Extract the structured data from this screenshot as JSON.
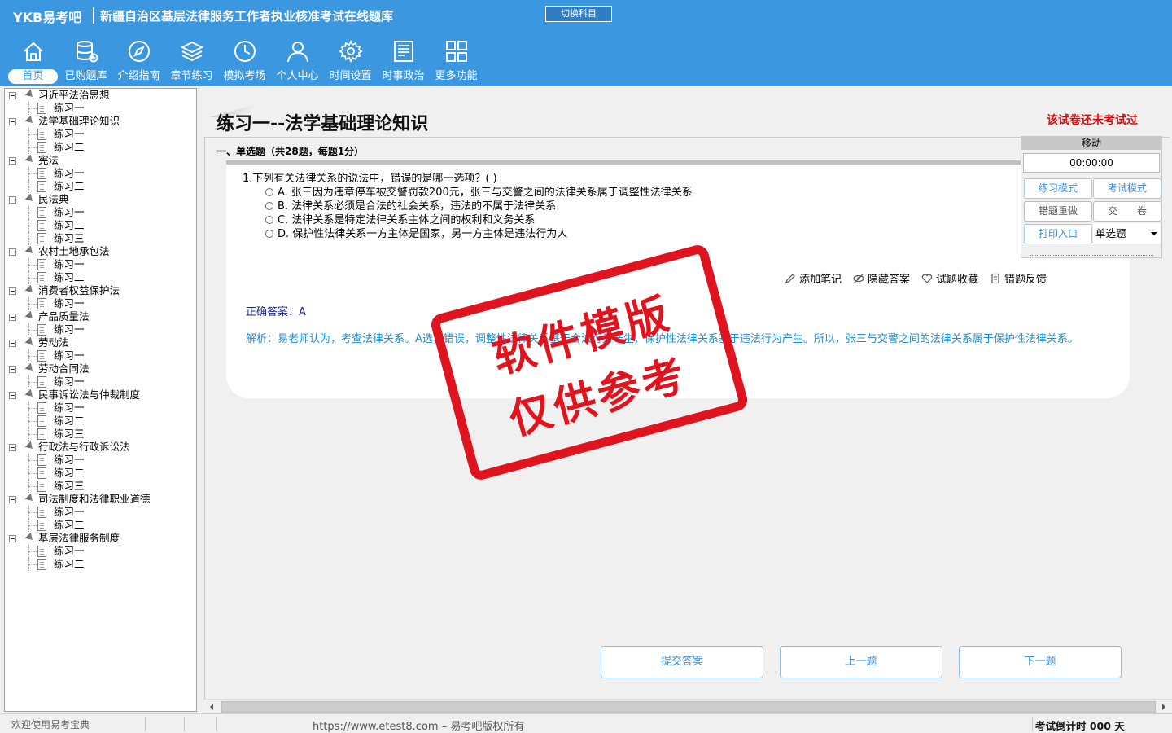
{
  "header": {
    "logo": "YKB易考吧",
    "title": "新疆自治区基层法律服务工作者执业核准考试在线题库",
    "switch_label": "切换科目"
  },
  "nav": [
    {
      "label": "首页",
      "icon": "home-icon"
    },
    {
      "label": "已购题库",
      "icon": "database-icon"
    },
    {
      "label": "介绍指南",
      "icon": "compass-icon"
    },
    {
      "label": "章节练习",
      "icon": "layers-icon"
    },
    {
      "label": "模拟考场",
      "icon": "clock-icon"
    },
    {
      "label": "个人中心",
      "icon": "user-icon"
    },
    {
      "label": "时间设置",
      "icon": "gear-icon"
    },
    {
      "label": "时事政治",
      "icon": "news-icon"
    },
    {
      "label": "更多功能",
      "icon": "grid-icon"
    }
  ],
  "tree": [
    {
      "label": "习近平法治思想",
      "children": [
        "练习一"
      ]
    },
    {
      "label": "法学基础理论知识",
      "children": [
        "练习一",
        "练习二"
      ]
    },
    {
      "label": "宪法",
      "children": [
        "练习一",
        "练习二"
      ]
    },
    {
      "label": "民法典",
      "children": [
        "练习一",
        "练习二",
        "练习三"
      ]
    },
    {
      "label": "农村土地承包法",
      "children": [
        "练习一",
        "练习二"
      ]
    },
    {
      "label": "消费者权益保护法",
      "children": [
        "练习一"
      ]
    },
    {
      "label": "产品质量法",
      "children": [
        "练习一"
      ]
    },
    {
      "label": "劳动法",
      "children": [
        "练习一"
      ]
    },
    {
      "label": "劳动合同法",
      "children": [
        "练习一"
      ]
    },
    {
      "label": "民事诉讼法与仲裁制度",
      "children": [
        "练习一",
        "练习二",
        "练习三"
      ]
    },
    {
      "label": "行政法与行政诉讼法",
      "children": [
        "练习一",
        "练习二",
        "练习三"
      ]
    },
    {
      "label": "司法制度和法律职业道德",
      "children": [
        "练习一",
        "练习二"
      ]
    },
    {
      "label": "基层法律服务制度",
      "children": [
        "练习一",
        "练习二"
      ]
    }
  ],
  "main": {
    "heading": "练习一--法学基础理论知识",
    "not_taken": "该试卷还未考试过",
    "section": "一、单选题（共28题，每题1分）",
    "question": "1.下列有关法律关系的说法中，错误的是哪一选项？( )",
    "options": [
      "A. 张三因为违章停车被交警罚款200元，张三与交警之间的法律关系属于调整性法律关系",
      "B. 法律关系必须是合法的社会关系，违法的不属于法律关系",
      "C. 法律关系是特定法律关系主体之间的权利和义务关系",
      "D. 保护性法律关系一方主体是国家，另一方主体是违法行为人"
    ],
    "tools": {
      "note": "添加笔记",
      "hide": "隐藏答案",
      "fav": "试题收藏",
      "report": "错题反馈"
    },
    "answer": "正确答案：A",
    "analysis": "解析：易老师认为，考查法律关系。A选项错误，调整性法律关系基于合法行为产生，保护性法律关系基于违法行为产生。所以，张三与交警之间的法律关系属于保护性法律关系。"
  },
  "ctrl": {
    "head": "移动",
    "timer": "00:00:00",
    "practice": "练习模式",
    "exam": "考试模式",
    "redo": "错题重做",
    "submit": "交　　卷",
    "print": "打印入口",
    "qtype": "单选题"
  },
  "buttons": {
    "submit_answer": "提交答案",
    "prev": "上一题",
    "next": "下一题"
  },
  "status": {
    "welcome": "欢迎使用易考宝典",
    "url": "https://www.etest8.com – 易考吧版权所有",
    "countdown": "考试倒计时 000 天"
  },
  "stamp": {
    "line1": "软件模版",
    "line2": "仅供参考"
  },
  "colors": {
    "header": "#3a97e0",
    "stamp": "#e0141e",
    "warning": "#d01010",
    "analysis": "#1f8ccf"
  }
}
